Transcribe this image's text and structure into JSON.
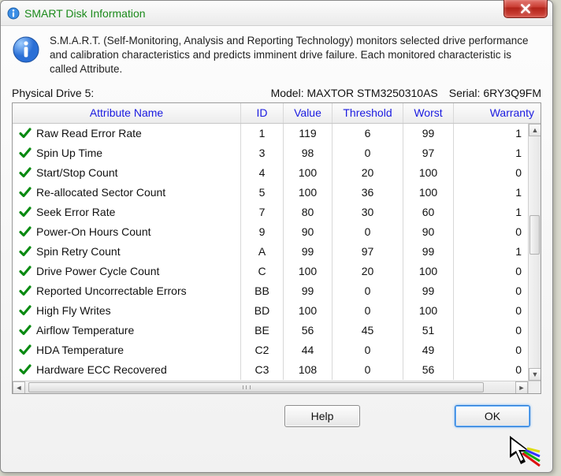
{
  "window": {
    "title": "SMART Disk Information"
  },
  "intro": "S.M.A.R.T. (Self-Monitoring, Analysis and Reporting Technology) monitors selected drive performance and calibration characteristics and predicts imminent drive failure. Each monitored characteristic is called Attribute.",
  "meta": {
    "drive_label": "Physical Drive 5:",
    "model_label": "Model:",
    "model_value": "MAXTOR STM3250310AS",
    "serial_label": "Serial:",
    "serial_value": "6RY3Q9FM"
  },
  "columns": {
    "name": "Attribute Name",
    "id": "ID",
    "value": "Value",
    "threshold": "Threshold",
    "worst": "Worst",
    "warranty": "Warranty"
  },
  "rows": [
    {
      "name": "Raw Read Error Rate",
      "id": "1",
      "value": "119",
      "threshold": "6",
      "worst": "99",
      "warranty": "1"
    },
    {
      "name": "Spin Up Time",
      "id": "3",
      "value": "98",
      "threshold": "0",
      "worst": "97",
      "warranty": "1"
    },
    {
      "name": "Start/Stop Count",
      "id": "4",
      "value": "100",
      "threshold": "20",
      "worst": "100",
      "warranty": "0"
    },
    {
      "name": "Re-allocated Sector Count",
      "id": "5",
      "value": "100",
      "threshold": "36",
      "worst": "100",
      "warranty": "1"
    },
    {
      "name": "Seek Error Rate",
      "id": "7",
      "value": "80",
      "threshold": "30",
      "worst": "60",
      "warranty": "1"
    },
    {
      "name": "Power-On Hours Count",
      "id": "9",
      "value": "90",
      "threshold": "0",
      "worst": "90",
      "warranty": "0"
    },
    {
      "name": "Spin Retry Count",
      "id": "A",
      "value": "99",
      "threshold": "97",
      "worst": "99",
      "warranty": "1"
    },
    {
      "name": "Drive Power Cycle Count",
      "id": "C",
      "value": "100",
      "threshold": "20",
      "worst": "100",
      "warranty": "0"
    },
    {
      "name": "Reported Uncorrectable Errors",
      "id": "BB",
      "value": "99",
      "threshold": "0",
      "worst": "99",
      "warranty": "0"
    },
    {
      "name": "High Fly Writes",
      "id": "BD",
      "value": "100",
      "threshold": "0",
      "worst": "100",
      "warranty": "0"
    },
    {
      "name": "Airflow Temperature",
      "id": "BE",
      "value": "56",
      "threshold": "45",
      "worst": "51",
      "warranty": "0"
    },
    {
      "name": "HDA Temperature",
      "id": "C2",
      "value": "44",
      "threshold": "0",
      "worst": "49",
      "warranty": "0"
    },
    {
      "name": "Hardware ECC Recovered",
      "id": "C3",
      "value": "108",
      "threshold": "0",
      "worst": "56",
      "warranty": "0"
    }
  ],
  "buttons": {
    "help": "Help",
    "ok": "OK"
  }
}
